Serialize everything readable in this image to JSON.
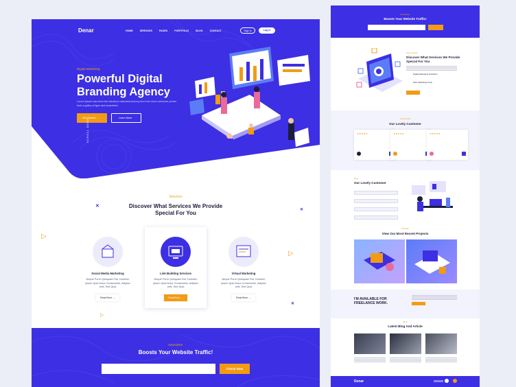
{
  "main": {
    "logo": "Denar",
    "nav": [
      "HOME",
      "SERVICES",
      "PAGES",
      "PORTFOLIO",
      "BLOG",
      "CONTACT"
    ],
    "signin": "Sign In",
    "login": "Log In",
    "hero_tag": "Digital Marketing",
    "hero_title": "Powerful Digital Branding Agency",
    "hero_text": "Lorem Ipsum has been the industry's standard dummy text ever since unknown printer took a galley of type and scrambled",
    "btn_start": "Get Started",
    "btn_learn": "Learn More",
    "scroll": "SCROLL DOWN",
    "services_tag": "Services",
    "services_title": "Discover What Services We Provide Special For You",
    "services": [
      {
        "name": "Social Media Marketing",
        "desc": "Neque Porro Quisquam Est, Dolorem Ipsum Quia Dolor Consectetur, Adipisci velit, Sed Quia",
        "btn": "Read More"
      },
      {
        "name": "Link Building Services",
        "desc": "Neque Porro Quisquam Est, Dolorem Ipsum Quia Dolor Consectetur, Adipisci velit, Sed Quia",
        "btn": "Read More"
      },
      {
        "name": "Virtual Marketing",
        "desc": "Neque Porro Quisquam Est, Dolorem Ipsum Quia Dolor Consectetur, Adipisci velit, Sed Quia",
        "btn": "Read More"
      }
    ],
    "newsletter_tag": "Newsletter",
    "newsletter_title": "Boosts Your Website Traffic!",
    "newsletter_btn": "Check Now"
  },
  "side": {
    "nl_tag": "Newsletter",
    "nl_title": "Boosts Your Website Traffic!",
    "about_tag": "About Denar",
    "about_title": "Discover What Services We Provide Special For You",
    "about_items": [
      "Digital Marketing Solutions",
      "Web Marketing Tools"
    ],
    "testimonial_tag": "Testimonial",
    "testimonial_title": "Our Lovely Customer",
    "faq_tag": "FAQ",
    "faq_title": "Our Lovely Customer",
    "projects_tag": "Portfolio",
    "projects_title": "View Our Most Recent Projects",
    "freelance_title": "I'M AVAILABLE FOR FREELANCE WORK.",
    "blog_tag": "Blog",
    "blog_title": "Latest Blog And Article",
    "footer_logo": "Denar"
  },
  "colors": {
    "brand": "#3d2fe3",
    "accent": "#f29b15"
  }
}
